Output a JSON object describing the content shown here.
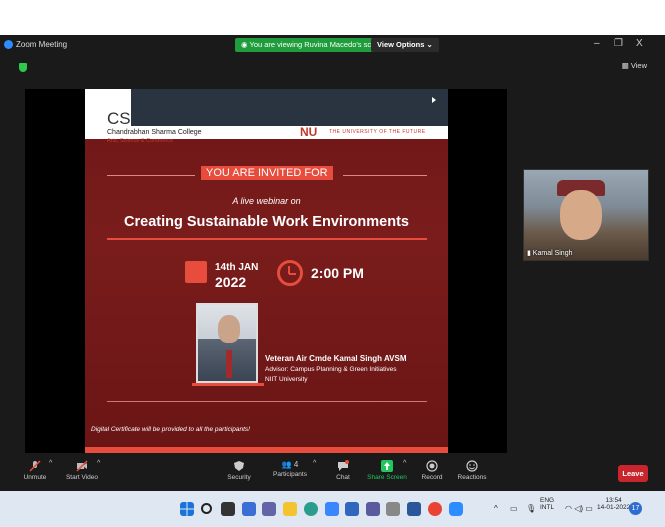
{
  "window": {
    "title": "Zoom Meeting",
    "viewing_banner": "You are viewing Ruvina Macedo's screen",
    "view_options": "View Options ⌄",
    "minimize": "–",
    "restore": "❐",
    "close": "X",
    "view_label": "View"
  },
  "slide": {
    "college_short": "CS",
    "college_name": "Chandrabhan Sharma College",
    "college_sub": "Arts, Science & Commerce",
    "partner_logo": "NU",
    "partner_tagline": "THE UNIVERSITY OF THE FUTURE",
    "invited": "YOU ARE INVITED FOR",
    "live": "A live webinar on",
    "title": "Creating Sustainable Work Environments",
    "date_day": "14th JAN",
    "date_year": "2022",
    "time": "2:00 PM",
    "speaker_name": "Veteran Air Cmde Kamal Singh AVSM",
    "speaker_role": "Advisor: Campus Planning & Green Initiatives",
    "speaker_org": "NIIT University",
    "certificate_note": "Digital Certificate will be provided to all the participants!"
  },
  "participant_thumb": {
    "name": "Kamal Singh"
  },
  "toolbar": {
    "unmute": "Unmute",
    "start_video": "Start Video",
    "security": "Security",
    "participants": "Participants",
    "participants_count": "4",
    "chat": "Chat",
    "chat_badge": "1",
    "share_screen": "Share Screen",
    "record": "Record",
    "reactions": "Reactions",
    "leave": "Leave"
  },
  "taskbar": {
    "lang1": "ENG",
    "lang2": "INTL",
    "time": "13:54",
    "date": "14-01-2022",
    "notifications": "17"
  },
  "colors": {
    "accent_red": "#e74c3c",
    "zoom_green": "#1f9c3c",
    "share_green": "#22c55e",
    "zoom_blue": "#2d8cff"
  }
}
